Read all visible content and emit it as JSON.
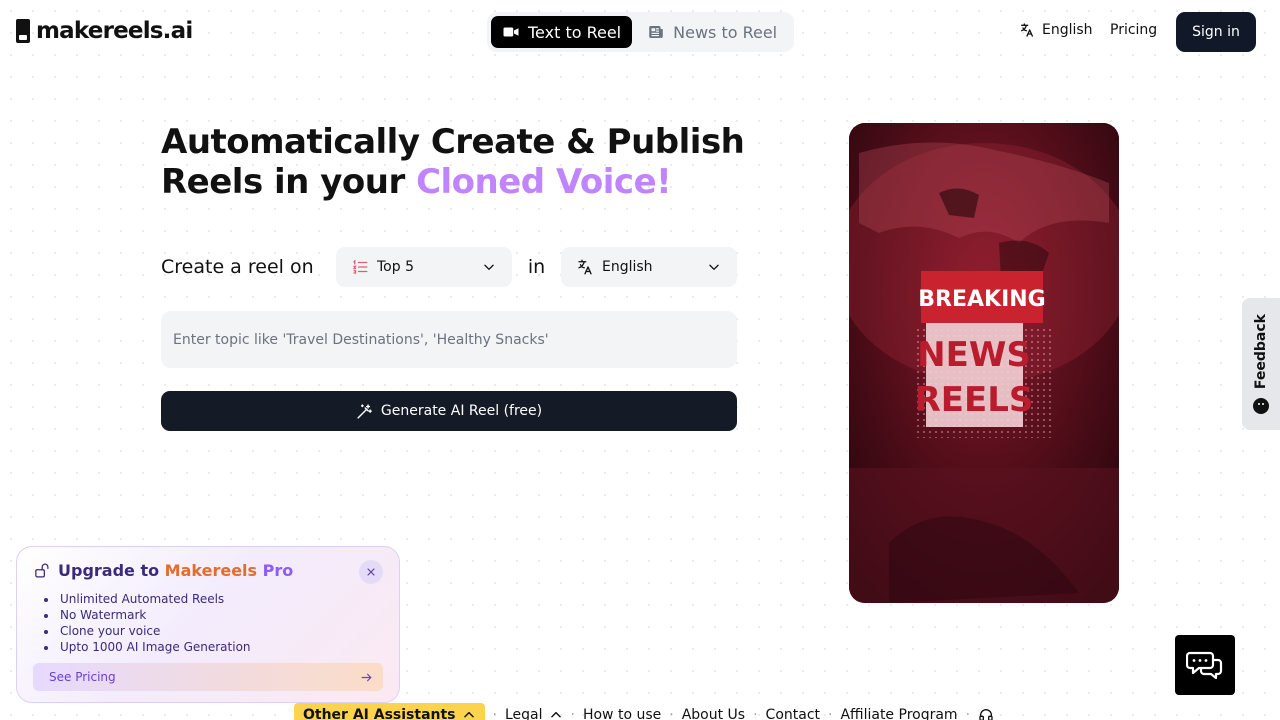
{
  "header": {
    "logo_text": "makereels.ai",
    "tabs": [
      {
        "label": "Text to Reel",
        "icon": "video-camera-icon",
        "active": true
      },
      {
        "label": "News to Reel",
        "icon": "newspaper-icon",
        "active": false
      }
    ],
    "language": "English",
    "pricing": "Pricing",
    "sign_in": "Sign in"
  },
  "hero": {
    "title_part1": "Automatically Create & Publish Reels in your ",
    "title_accent": "Cloned Voice!",
    "accent_color": "#c084fc"
  },
  "form": {
    "create_label": "Create a reel on",
    "reel_type": "Top 5",
    "in_label": "in",
    "language": "English",
    "topic_placeholder": "Enter topic like 'Travel Destinations', 'Healthy Snacks'",
    "topic_value": "",
    "generate_label": "Generate AI Reel (free)"
  },
  "preview": {
    "badge": "BREAKING",
    "line1": "NEWS",
    "line2": "REELS"
  },
  "feedback": {
    "label": "Feedback"
  },
  "upgrade": {
    "title_prefix": "Upgrade to ",
    "brand_part1": "Makereels",
    "brand_part2": " Pro",
    "features": [
      "Unlimited Automated Reels",
      "No Watermark",
      "Clone your voice",
      "Upto 1000 AI Image Generation"
    ],
    "see_pricing": "See Pricing"
  },
  "footer": {
    "other_ai": "Other AI Assistants",
    "links": [
      "Legal",
      "How to use",
      "About Us",
      "Contact",
      "Affiliate Program"
    ]
  },
  "colors": {
    "primary_dark": "#111827",
    "purple_accent": "#c084fc",
    "orange_brand": "#e26d2d",
    "footer_yellow": "#fcd34d"
  }
}
